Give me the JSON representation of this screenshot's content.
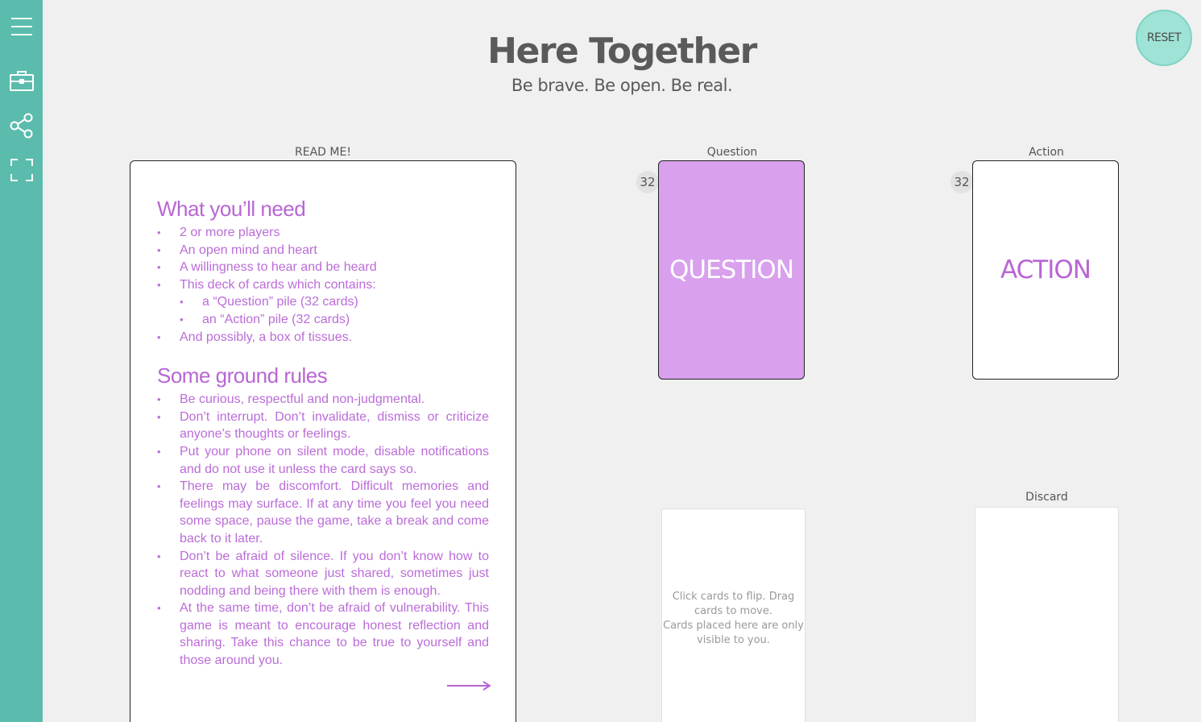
{
  "sidebar": {
    "items": [
      {
        "icon": "menu-icon"
      },
      {
        "icon": "toolbox-icon"
      },
      {
        "icon": "share-icon"
      },
      {
        "icon": "fullscreen-icon"
      }
    ]
  },
  "reset_label": "RESET",
  "header": {
    "title": "Here Together",
    "subtitle": "Be brave. Be open. Be real."
  },
  "piles": {
    "readme": {
      "label": "READ ME!"
    },
    "question": {
      "label": "Question",
      "count": "32",
      "face": "QUESTION"
    },
    "action": {
      "label": "Action",
      "count": "32",
      "face": "ACTION"
    },
    "hand": {
      "hint_line1": "Click cards to flip.   Drag cards to move.",
      "hint_line2": "Cards placed here are only visible to you."
    },
    "discard": {
      "label": "Discard"
    }
  },
  "readme_card": {
    "section1_title": "What you’ll need",
    "section1_items": [
      "2 or more players",
      "An open mind and heart",
      "A willingness to hear and be heard",
      "This deck of cards which contains:"
    ],
    "section1_subitems": [
      "a “Question” pile (32 cards)",
      "an “Action” pile (32 cards)"
    ],
    "section1_last": "And possibly, a box of tissues.",
    "section2_title": "Some ground rules",
    "section2_items": [
      "Be curious, respectful and non-judgmental.",
      "Don’t interrupt. Don’t invalidate, dismiss or criticize anyone’s thoughts or feelings.",
      "Put your phone on silent mode, disable notifications and do not use it unless the card says so.",
      "There may be discomfort. Difficult memories and feelings may surface. If at any time you feel you need some space, pause the game, take a break and come back to it later.",
      "Don’t be afraid of silence. If you don’t know how to react to what someone just shared, sometimes just nodding and being there with them is enough.",
      "At the same time, don’t be afraid of vulnerability. This game is meant to encourage honest reflection and sharing. Take this chance to be true to yourself and those around you."
    ]
  },
  "colors": {
    "sidebar": "#5bbcad",
    "accent": "#b866d4",
    "question_card": "#d9a0ee",
    "reset": "#9ee3d6"
  }
}
